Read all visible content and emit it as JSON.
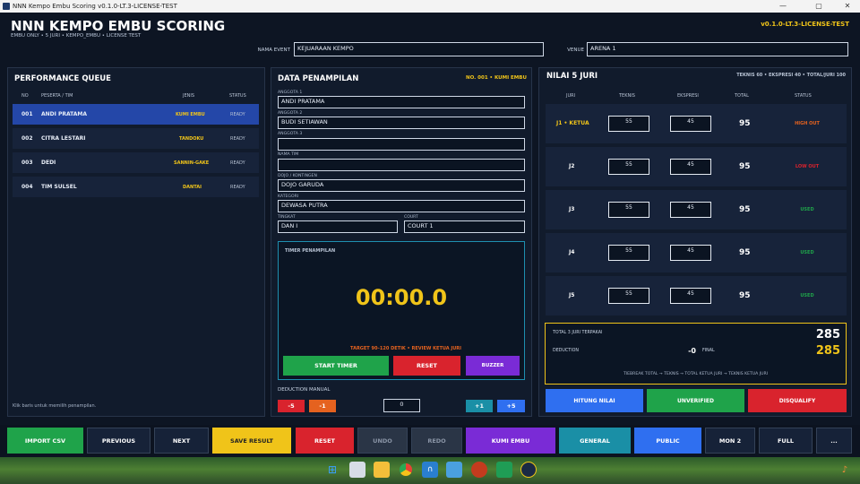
{
  "window": {
    "title": "NNN Kempo Embu Scoring v0.1.0-LT.3-LICENSE-TEST"
  },
  "header": {
    "app_title": "NNN KEMPO EMBU SCORING",
    "subtitle": "EMBU ONLY • 5 JURI • KEMPO_EMBU • LICENSE TEST",
    "version": "v0.1.0-LT.3-LICENSE-TEST",
    "event_label": "NAMA EVENT",
    "event_value": "KEJUARAAN KEMPO",
    "venue_label": "VENUE",
    "venue_value": "ARENA 1"
  },
  "queue": {
    "title": "PERFORMANCE QUEUE",
    "columns": {
      "no": "NO",
      "peserta": "PESERTA / TIM",
      "jenis": "JENIS",
      "status": "STATUS"
    },
    "rows": [
      {
        "no": "001",
        "name": "ANDI PRATAMA",
        "jenis": "KUMI EMBU",
        "status": "READY"
      },
      {
        "no": "002",
        "name": "CITRA LESTARI",
        "jenis": "TANDOKU",
        "status": "READY"
      },
      {
        "no": "003",
        "name": "DEDI",
        "jenis": "SANNIN-GAKE",
        "status": "READY"
      },
      {
        "no": "004",
        "name": "TIM SULSEL",
        "jenis": "DANTAI",
        "status": "READY"
      }
    ],
    "hint": "Klik baris untuk memilih penampilan."
  },
  "data": {
    "title": "DATA PENAMPILAN",
    "badge": "NO. 001 • KUMI EMBU",
    "anggota1_label": "ANGGOTA 1",
    "anggota1": "ANDI PRATAMA",
    "anggota2_label": "ANGGOTA 2",
    "anggota2": "BUDI SETIAWAN",
    "anggota3_label": "ANGGOTA 3",
    "anggota3": "",
    "tim_label": "NAMA TIM",
    "tim": "",
    "dojo_label": "DOJO / KONTINGEN",
    "dojo": "DOJO GARUDA",
    "kategori_label": "KATEGORI",
    "kategori": "DEWASA PUTRA",
    "tingkat_label": "TINGKAT",
    "tingkat": "DAN I",
    "court_label": "COURT",
    "court": "COURT 1"
  },
  "timer": {
    "title": "TIMER PENAMPILAN",
    "value": "00:00.0",
    "target": "TARGET 90–120 DETIK • REVIEW KETUA JURI",
    "start": "START TIMER",
    "reset": "RESET",
    "buzzer": "BUZZER"
  },
  "deduction": {
    "title": "DEDUCTION MANUAL",
    "m5": "-5",
    "m1": "-1",
    "value": "0",
    "p1": "+1",
    "p5": "+5"
  },
  "juri": {
    "title": "NILAI 5 JURI",
    "info": "TEKNIS 60 • EKSPRESI 40 • TOTAL/JURI 100",
    "columns": {
      "juri": "JURI",
      "teknis": "TEKNIS",
      "ekspresi": "EKSPRESI",
      "total": "TOTAL",
      "status": "STATUS"
    },
    "rows": [
      {
        "name": "J1 • KETUA",
        "teknis": "55",
        "ekspresi": "45",
        "total": "95",
        "status": "HIGH OUT"
      },
      {
        "name": "J2",
        "teknis": "55",
        "ekspresi": "45",
        "total": "95",
        "status": "LOW OUT"
      },
      {
        "name": "J3",
        "teknis": "55",
        "ekspresi": "45",
        "total": "95",
        "status": "USED"
      },
      {
        "name": "J4",
        "teknis": "55",
        "ekspresi": "45",
        "total": "95",
        "status": "USED"
      },
      {
        "name": "J5",
        "teknis": "55",
        "ekspresi": "45",
        "total": "95",
        "status": "USED"
      }
    ]
  },
  "summary": {
    "total_label": "TOTAL 3 JURI TERPAKAI",
    "total": "285",
    "deduction_label": "DEDUCTION",
    "deduction": "-0",
    "final_label": "FINAL",
    "final": "285",
    "tiebreak": "TIEBREAK TOTAL → TEKNIS → TOTAL KETUA JURI → TEKNIS KETUA JURI"
  },
  "actions": {
    "hitung": "HITUNG NILAI",
    "unverified": "UNVERIFIED",
    "disqualify": "DISQUALIFY"
  },
  "toolbar": {
    "import": "IMPORT CSV",
    "previous": "PREVIOUS",
    "next": "NEXT",
    "save": "SAVE RESULT",
    "reset": "RESET",
    "undo": "UNDO",
    "redo": "REDO",
    "mode": "KUMI EMBU",
    "general": "GENERAL",
    "public": "PUBLIC",
    "mon": "MON 2",
    "full": "FULL",
    "more": "..."
  },
  "colors": {
    "accent": "#f0c419",
    "active_row": "#2447a8",
    "green": "#1fa34a",
    "red": "#d9232d",
    "purple": "#7a2bd6",
    "blue": "#2f6ff0",
    "teal": "#1a8fa6",
    "orange": "#e5621f"
  },
  "taskbar": {
    "icons": [
      "windows-icon",
      "files-icon",
      "folder-icon",
      "chrome-icon",
      "app-icon",
      "photos-icon",
      "game-icon",
      "sheet-icon",
      "kempo-icon",
      "bell-icon"
    ]
  }
}
